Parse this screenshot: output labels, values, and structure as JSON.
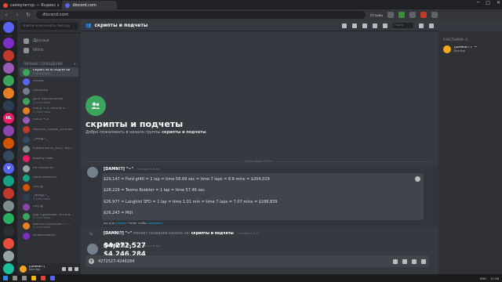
{
  "browser": {
    "tabs": [
      {
        "label": "самоучитор — Яндекс з"
      },
      {
        "label": "discord.com"
      }
    ],
    "url": "discord.com",
    "reviews_label": "Отзывы"
  },
  "servers": [
    {
      "icon": "discord-home-icon",
      "color": "#5865f2",
      "label": ""
    },
    {
      "color": "#7b2ec8",
      "label": ""
    },
    {
      "color": "#c0392b",
      "label": ""
    },
    {
      "color": "#9b59b6",
      "label": ""
    },
    {
      "color": "#3ba55c",
      "label": ""
    },
    {
      "color": "#e67e22",
      "label": ""
    },
    {
      "color": "#2c3e50",
      "label": ""
    },
    {
      "color": "#e91e63",
      "label": "HL"
    },
    {
      "color": "#8e44ad",
      "label": ""
    },
    {
      "color": "#d35400",
      "label": ""
    },
    {
      "color": "#34495e",
      "label": ""
    },
    {
      "color": "#5865f2",
      "label": "V"
    },
    {
      "color": "#16a085",
      "label": ""
    },
    {
      "color": "#c0392b",
      "label": ""
    },
    {
      "color": "#7f8c8d",
      "label": ""
    },
    {
      "color": "#27ae60",
      "label": ""
    },
    {
      "color": "#2c2f33",
      "label": ""
    },
    {
      "color": "#e74c3c",
      "label": ""
    },
    {
      "color": "#95a5a6",
      "label": ""
    },
    {
      "color": "#1abc9c",
      "label": ""
    }
  ],
  "dm": {
    "search_placeholder": "Найти или начать беседу",
    "friends_label": "Друзья",
    "nitro_label": "Nitro",
    "section_header": "ЛИЧНЫЕ СООБЩЕНИЯ",
    "add_icon": "+",
    "items": [
      {
        "name": "скрипты и подчеты",
        "sub": "3 участника",
        "color": "#3ba55c",
        "active": true
      },
      {
        "name": "Inside",
        "sub": "",
        "color": "#5865f2"
      },
      {
        "name": "recokola",
        "sub": "",
        "color": "#747f8d"
      },
      {
        "name": "Для пасхалочек",
        "sub": "3 участника",
        "color": "#3ba55c"
      },
      {
        "name": "Наса <3, Розги U ...",
        "sub": "3 участника",
        "color": "#e67e22"
      },
      {
        "name": "Наса <3",
        "sub": "",
        "color": "#9b59b6"
      },
      {
        "name": "Mishka_roblox_official",
        "sub": "",
        "color": "#c0392b"
      },
      {
        "name": "_Slegt7_",
        "sub": "",
        "color": "#34495e"
      },
      {
        "name": "ItSalemonX_GD | Sm...",
        "sub": "",
        "color": "#7f8c8d"
      },
      {
        "name": "Каину Рим",
        "sub": "",
        "color": "#e91e63"
      },
      {
        "name": "Mr.noname",
        "sub": "",
        "color": "#95a5a6"
      },
      {
        "name": "salamolelium",
        "sub": "",
        "color": "#16a085"
      },
      {
        "name": "nej @",
        "sub": "",
        "color": "#d35400"
      },
      {
        "name": "_Sieg17_",
        "sub": "3 участника",
        "color": "#2c3e50"
      },
      {
        "name": "nej @",
        "sub": "",
        "color": "#8e44ad"
      },
      {
        "name": "Шу Куриний, ЯЛ.ЕЯ...",
        "sub": "3 участника",
        "color": "#3ba55c"
      },
      {
        "name": "Naruto Uzumaki 7, ...",
        "sub": "3 участника",
        "color": "#e67e22"
      },
      {
        "name": "DrakeTownD",
        "sub": "",
        "color": "#7b2ec8"
      }
    ]
  },
  "user": {
    "name": "[DAMN!?]",
    "status": "Бал Avp"
  },
  "channel": {
    "title": "скрипты и подчеты",
    "search_placeholder": "Поиск",
    "welcome_title": "скрипты и подчеты",
    "welcome_prefix": "Добро пожаловать в начало группы",
    "welcome_group": "скрипты и подчеты",
    "date_divider": "30 октября 2020 г."
  },
  "messages": {
    "author": "[DAMN!?] \"~\"",
    "time1": "Сегодня в 8:56",
    "lines": [
      "$29,147 = Ford gt40 = 1 lap = time 56.69 sec = time 7 laps = 8.8 mins = $204,029",
      "$28,229 = Tesmo Rodster = 1 lap = time 57.46 sec",
      "$26,977 = Langhini SFD = 1 lap = time 1.01 min = time 7 laps = 7.07 mins = $188,839",
      "$26,243 = Mdl"
    ],
    "edit_hint_prefix": "esc для",
    "edit_hint_cancel": "отмены",
    "edit_hint_mid": "• enter чтобы",
    "edit_hint_save": "сохранить",
    "sys_author": "[DAMN!?] \"~\"",
    "sys_text": "меняет название канала на:",
    "sys_channel": "скрипты и подчеты",
    "sys_time": "Сегодня в 9:00",
    "time2": "Сегодня в 9:04",
    "big1": "$4,246,284",
    "big2": "$4,272,527"
  },
  "composer": {
    "value": "4272527-4246284"
  },
  "members": {
    "header": "УЧАСТНИКИ—1",
    "items": [
      {
        "name": "[DAMN!?] \"~\"",
        "status": "Бал Avp"
      }
    ]
  },
  "taskbar": {
    "lang": "ENG",
    "time": "11:56"
  }
}
